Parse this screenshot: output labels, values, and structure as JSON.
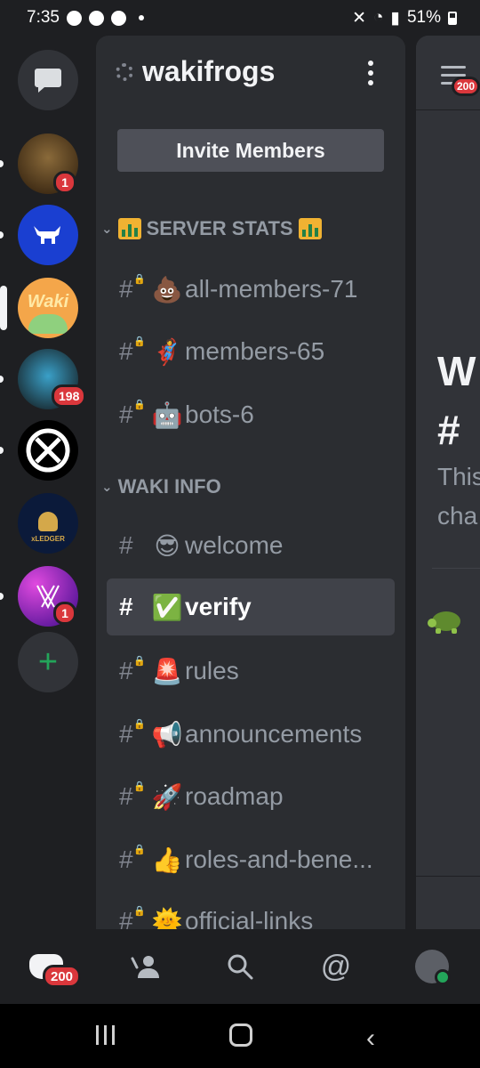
{
  "status_bar": {
    "time": "7:35",
    "battery": "51%"
  },
  "server": {
    "name": "wakifrogs",
    "invite_label": "Invite Members"
  },
  "rail": {
    "servers": [
      {
        "name": "dm",
        "badge": ""
      },
      {
        "name": "server-1",
        "badge": "1"
      },
      {
        "name": "server-2",
        "badge": ""
      },
      {
        "name": "wakifrogs",
        "label": "Waki",
        "badge": ""
      },
      {
        "name": "server-4",
        "badge": "198"
      },
      {
        "name": "server-5",
        "badge": ""
      },
      {
        "name": "xledger",
        "label": "xLEDGER",
        "badge": ""
      },
      {
        "name": "server-7",
        "badge": "1"
      }
    ],
    "add_label": "+"
  },
  "categories": [
    {
      "name": "SERVER STATS",
      "channels": [
        {
          "name": "all-members-71",
          "emoji": "💩",
          "locked": true
        },
        {
          "name": "members-65",
          "emoji": "🦸",
          "locked": true
        },
        {
          "name": "bots-6",
          "emoji": "🤖",
          "locked": true
        }
      ]
    },
    {
      "name": "WAKI INFO",
      "channels": [
        {
          "name": "welcome",
          "emoji": "😎",
          "locked": false
        },
        {
          "name": "verify",
          "emoji": "✅",
          "locked": false,
          "active": true
        },
        {
          "name": "rules",
          "emoji": "🚨",
          "locked": true
        },
        {
          "name": "announcements",
          "emoji": "📢",
          "locked": true
        },
        {
          "name": "roadmap",
          "emoji": "🚀",
          "locked": true
        },
        {
          "name": "roles-and-bene...",
          "emoji": "👍",
          "locked": true
        },
        {
          "name": "official-links",
          "emoji": "🌞",
          "locked": true
        }
      ]
    }
  ],
  "chat_peek": {
    "badge": "200",
    "line1": "W",
    "line2": "#",
    "line3": "This",
    "line4": "cha"
  },
  "bottom_nav": {
    "home_badge": "200",
    "mention_label": "@"
  },
  "colors": {
    "accent_badge": "#da373c",
    "active_row": "#404249",
    "panel": "#2b2d31"
  }
}
